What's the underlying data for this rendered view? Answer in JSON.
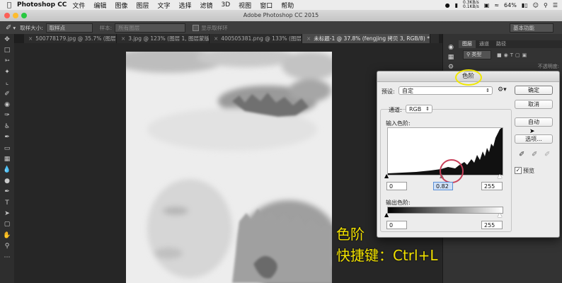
{
  "menubar": {
    "apple": "",
    "app_name": "Photoshop CC",
    "items": [
      "文件",
      "编辑",
      "图像",
      "图层",
      "文字",
      "选择",
      "滤镜",
      "3D",
      "视图",
      "窗口",
      "帮助"
    ],
    "net_up": "0.3KB/s",
    "net_down": "0.1KB/s",
    "battery": "64%"
  },
  "window": {
    "title": "Adobe Photoshop CC 2015"
  },
  "options": {
    "sample_size_label": "取样大小:",
    "sample_size_value": "取样点",
    "sample_label": "样本:",
    "sample_value": "所有图层",
    "show_ring_label": "显示取样环",
    "workspace": "基本功能"
  },
  "tabs": [
    {
      "label": "500778179.jpg @ 35.7% (图层 1...",
      "active": false
    },
    {
      "label": "3.jpg @ 123% (图层 1, 图层蒙版...",
      "active": false
    },
    {
      "label": "400505381.png @ 133% (图层 1...",
      "active": false
    },
    {
      "label": "未标题-1 @ 37.8% (fengjing 拷贝 3, RGB/8) *",
      "active": true
    }
  ],
  "layers_panel": {
    "tabs": [
      "图层",
      "通道",
      "路径"
    ],
    "kind": "类型",
    "opacity_label": "不透明度:"
  },
  "levels": {
    "title": "色阶",
    "preset_label": "预设:",
    "preset_value": "自定",
    "channel_label": "通道:",
    "channel_value": "RGB",
    "input_label": "输入色阶:",
    "input_black": "0",
    "input_gamma": "0.82",
    "input_white": "255",
    "output_label": "输出色阶:",
    "output_black": "0",
    "output_white": "255",
    "buttons": {
      "ok": "确定",
      "cancel": "取消",
      "auto": "自动",
      "options": "选项..."
    },
    "preview_label": "预览"
  },
  "caption": {
    "line1": "色阶",
    "line2": "快捷键：Ctrl+L"
  },
  "colors": {
    "highlight_yellow": "#f1e800",
    "highlight_red": "#c8405a"
  }
}
